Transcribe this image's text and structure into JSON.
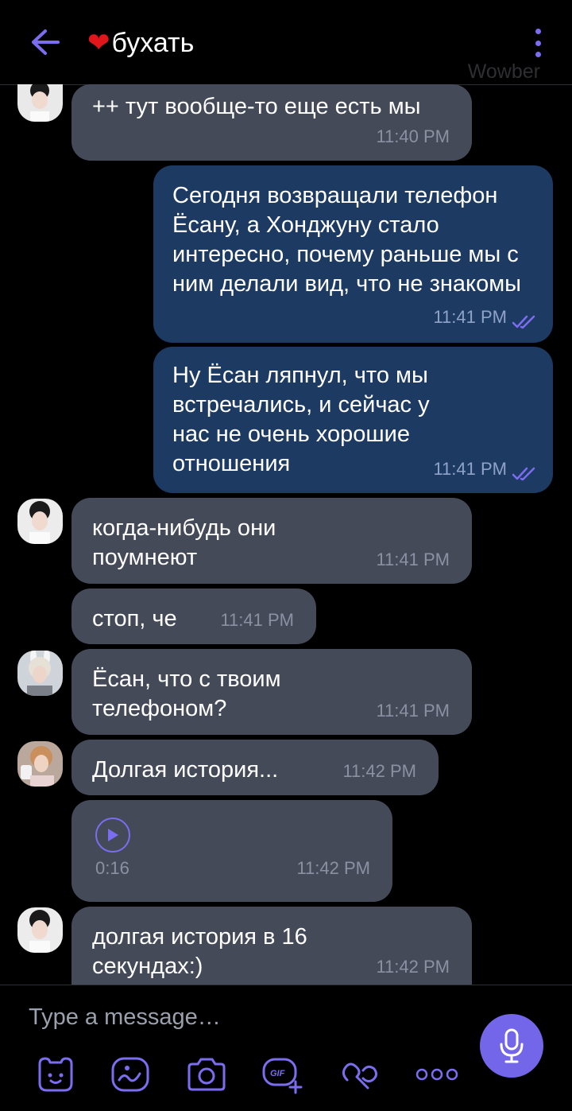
{
  "header": {
    "back_icon": "back-arrow-icon",
    "heart": "❤",
    "title": "бухать",
    "menu_icon": "kebab-menu-icon",
    "watermark": "Wowber"
  },
  "messages": [
    {
      "direction": "incoming",
      "text": "++ тут вообще-то еще есть мы",
      "time": "11:40 PM"
    },
    {
      "direction": "outgoing",
      "text": "Сегодня возвращали телефон Ёсану, а Хонджуну стало интересно, почему раньше мы с ним делали вид, что не знакомы",
      "time": "11:41 PM",
      "status": "read"
    },
    {
      "direction": "outgoing",
      "text": "Ну Ёсан ляпнул, что мы встречались, и сейчас у нас не очень хорошие отношения",
      "time": "11:41 PM",
      "status": "read"
    },
    {
      "direction": "incoming",
      "text": "когда-нибудь они поумнеют",
      "time": "11:41 PM"
    },
    {
      "direction": "incoming",
      "text": "стоп, че",
      "time": "11:41 PM"
    },
    {
      "direction": "incoming",
      "text": "Ёсан, что с твоим телефоном?",
      "time": "11:41 PM"
    },
    {
      "direction": "incoming",
      "text": "Долгая история...",
      "time": "11:42 PM"
    },
    {
      "direction": "incoming",
      "type": "voice",
      "duration": "0:16",
      "time": "11:42 PM"
    },
    {
      "direction": "incoming",
      "text": "долгая история в 16 секундах:)",
      "time": "11:42 PM"
    }
  ],
  "composer": {
    "placeholder": "Type a message…",
    "tools": [
      "sticker-icon",
      "doodle-icon",
      "camera-icon",
      "gif-icon",
      "chat-extensions-icon",
      "more-icon"
    ],
    "mic_icon": "microphone-icon"
  },
  "colors": {
    "accent": "#7366e8",
    "incoming_bubble": "#454a59",
    "outgoing_bubble": "#1d3a63",
    "background": "#000000"
  }
}
